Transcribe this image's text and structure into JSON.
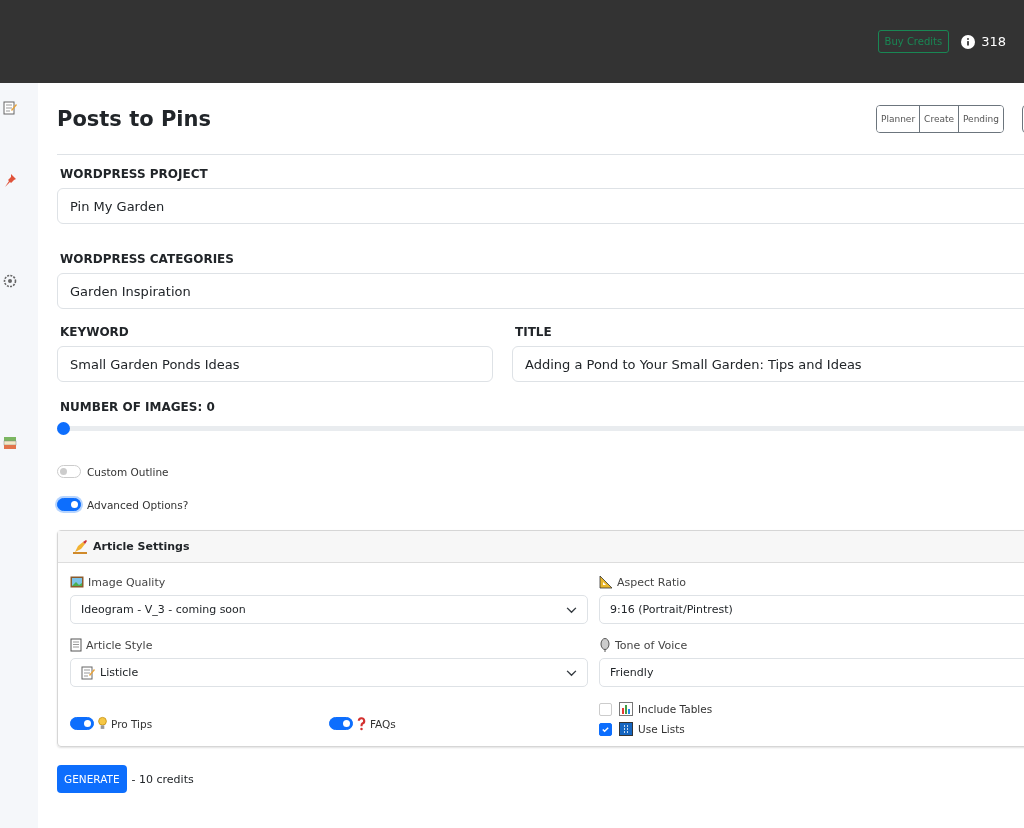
{
  "header": {
    "buy_credits": "Buy Credits",
    "credits": "318"
  },
  "page": {
    "title": "Posts to Pins",
    "nav": [
      {
        "label": "Planner",
        "selected": false
      },
      {
        "label": "Create",
        "selected": false
      },
      {
        "label": "Pending",
        "selected": false
      }
    ]
  },
  "project": {
    "label": "WORDPRESS PROJECT",
    "value": "Pin My Garden"
  },
  "categories": {
    "label": "WORDPRESS CATEGORIES",
    "value": "Garden Inspiration"
  },
  "keyword": {
    "label": "KEYWORD",
    "value": "Small Garden Ponds Ideas"
  },
  "title": {
    "label": "TITLE",
    "value": "Adding a Pond to Your Small Garden: Tips and Ideas"
  },
  "images": {
    "label": "NUMBER OF IMAGES: 0",
    "level": 0
  },
  "toggles": [
    {
      "label": "Custom Outline",
      "on": false
    },
    {
      "label": "Advanced Options?",
      "on": true
    }
  ],
  "article_settings": {
    "title": "Article Settings",
    "image_quality": {
      "label": "Image Quality",
      "value": "Ideogram - V_3 - coming soon"
    },
    "aspect_ratio": {
      "label": "Aspect Ratio",
      "value": "9:16 (Portrait/Pintrest)"
    },
    "article_style": {
      "label": "Article Style",
      "value": "Listicle"
    },
    "tone": {
      "label": "Tone of Voice",
      "value": "Friendly"
    },
    "pro_tips": {
      "label": "Pro Tips",
      "on": true
    },
    "faqs": {
      "label": "FAQs",
      "on": true
    },
    "include_tables": {
      "label": "Include Tables",
      "checked": false
    },
    "use_lists": {
      "label": "Use Lists",
      "checked": true
    }
  },
  "generate": {
    "label": "GENERATE",
    "cost": "- 10 credits"
  }
}
